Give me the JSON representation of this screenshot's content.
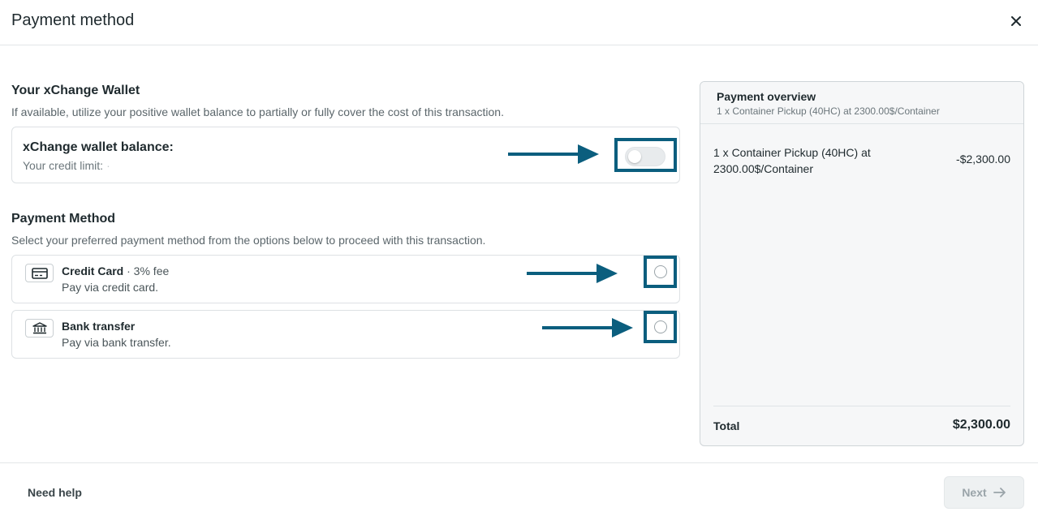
{
  "dialog": {
    "title": "Payment method",
    "close_icon": "close-icon"
  },
  "wallet": {
    "section_title": "Your xChange Wallet",
    "section_desc": "If available, utilize your positive wallet balance to partially or fully cover the cost of this transaction.",
    "balance_label": "xChange wallet balance:",
    "credit_limit_label": "Your credit limit:",
    "credit_limit_value": "·",
    "toggle_on": false
  },
  "payment": {
    "section_title": "Payment Method",
    "section_desc": "Select your preferred payment method from the options below to proceed with this transaction.",
    "options": [
      {
        "name": "Credit Card",
        "fee": " · 3% fee",
        "desc": "Pay via credit card.",
        "icon": "credit-card-icon",
        "selected": false
      },
      {
        "name": "Bank transfer",
        "fee": "",
        "desc": "Pay via bank transfer.",
        "icon": "bank-icon",
        "selected": false
      }
    ]
  },
  "overview": {
    "title": "Payment overview",
    "subtitle": "1 x Container Pickup (40HC) at 2300.00$/Container",
    "item_label": "1 x Container Pickup (40HC) at 2300.00$/Container",
    "item_amount": "-$2,300.00",
    "total_label": "Total",
    "total_value": "$2,300.00"
  },
  "footer": {
    "help_label": "Need help",
    "next_label": "Next",
    "next_icon": "arrow-right-icon"
  },
  "colors": {
    "annotation": "#0b5e7e",
    "text": "#1f2a2e",
    "muted": "#5b666b",
    "border": "#dde1e4",
    "panel_bg": "#f6f7f8"
  }
}
